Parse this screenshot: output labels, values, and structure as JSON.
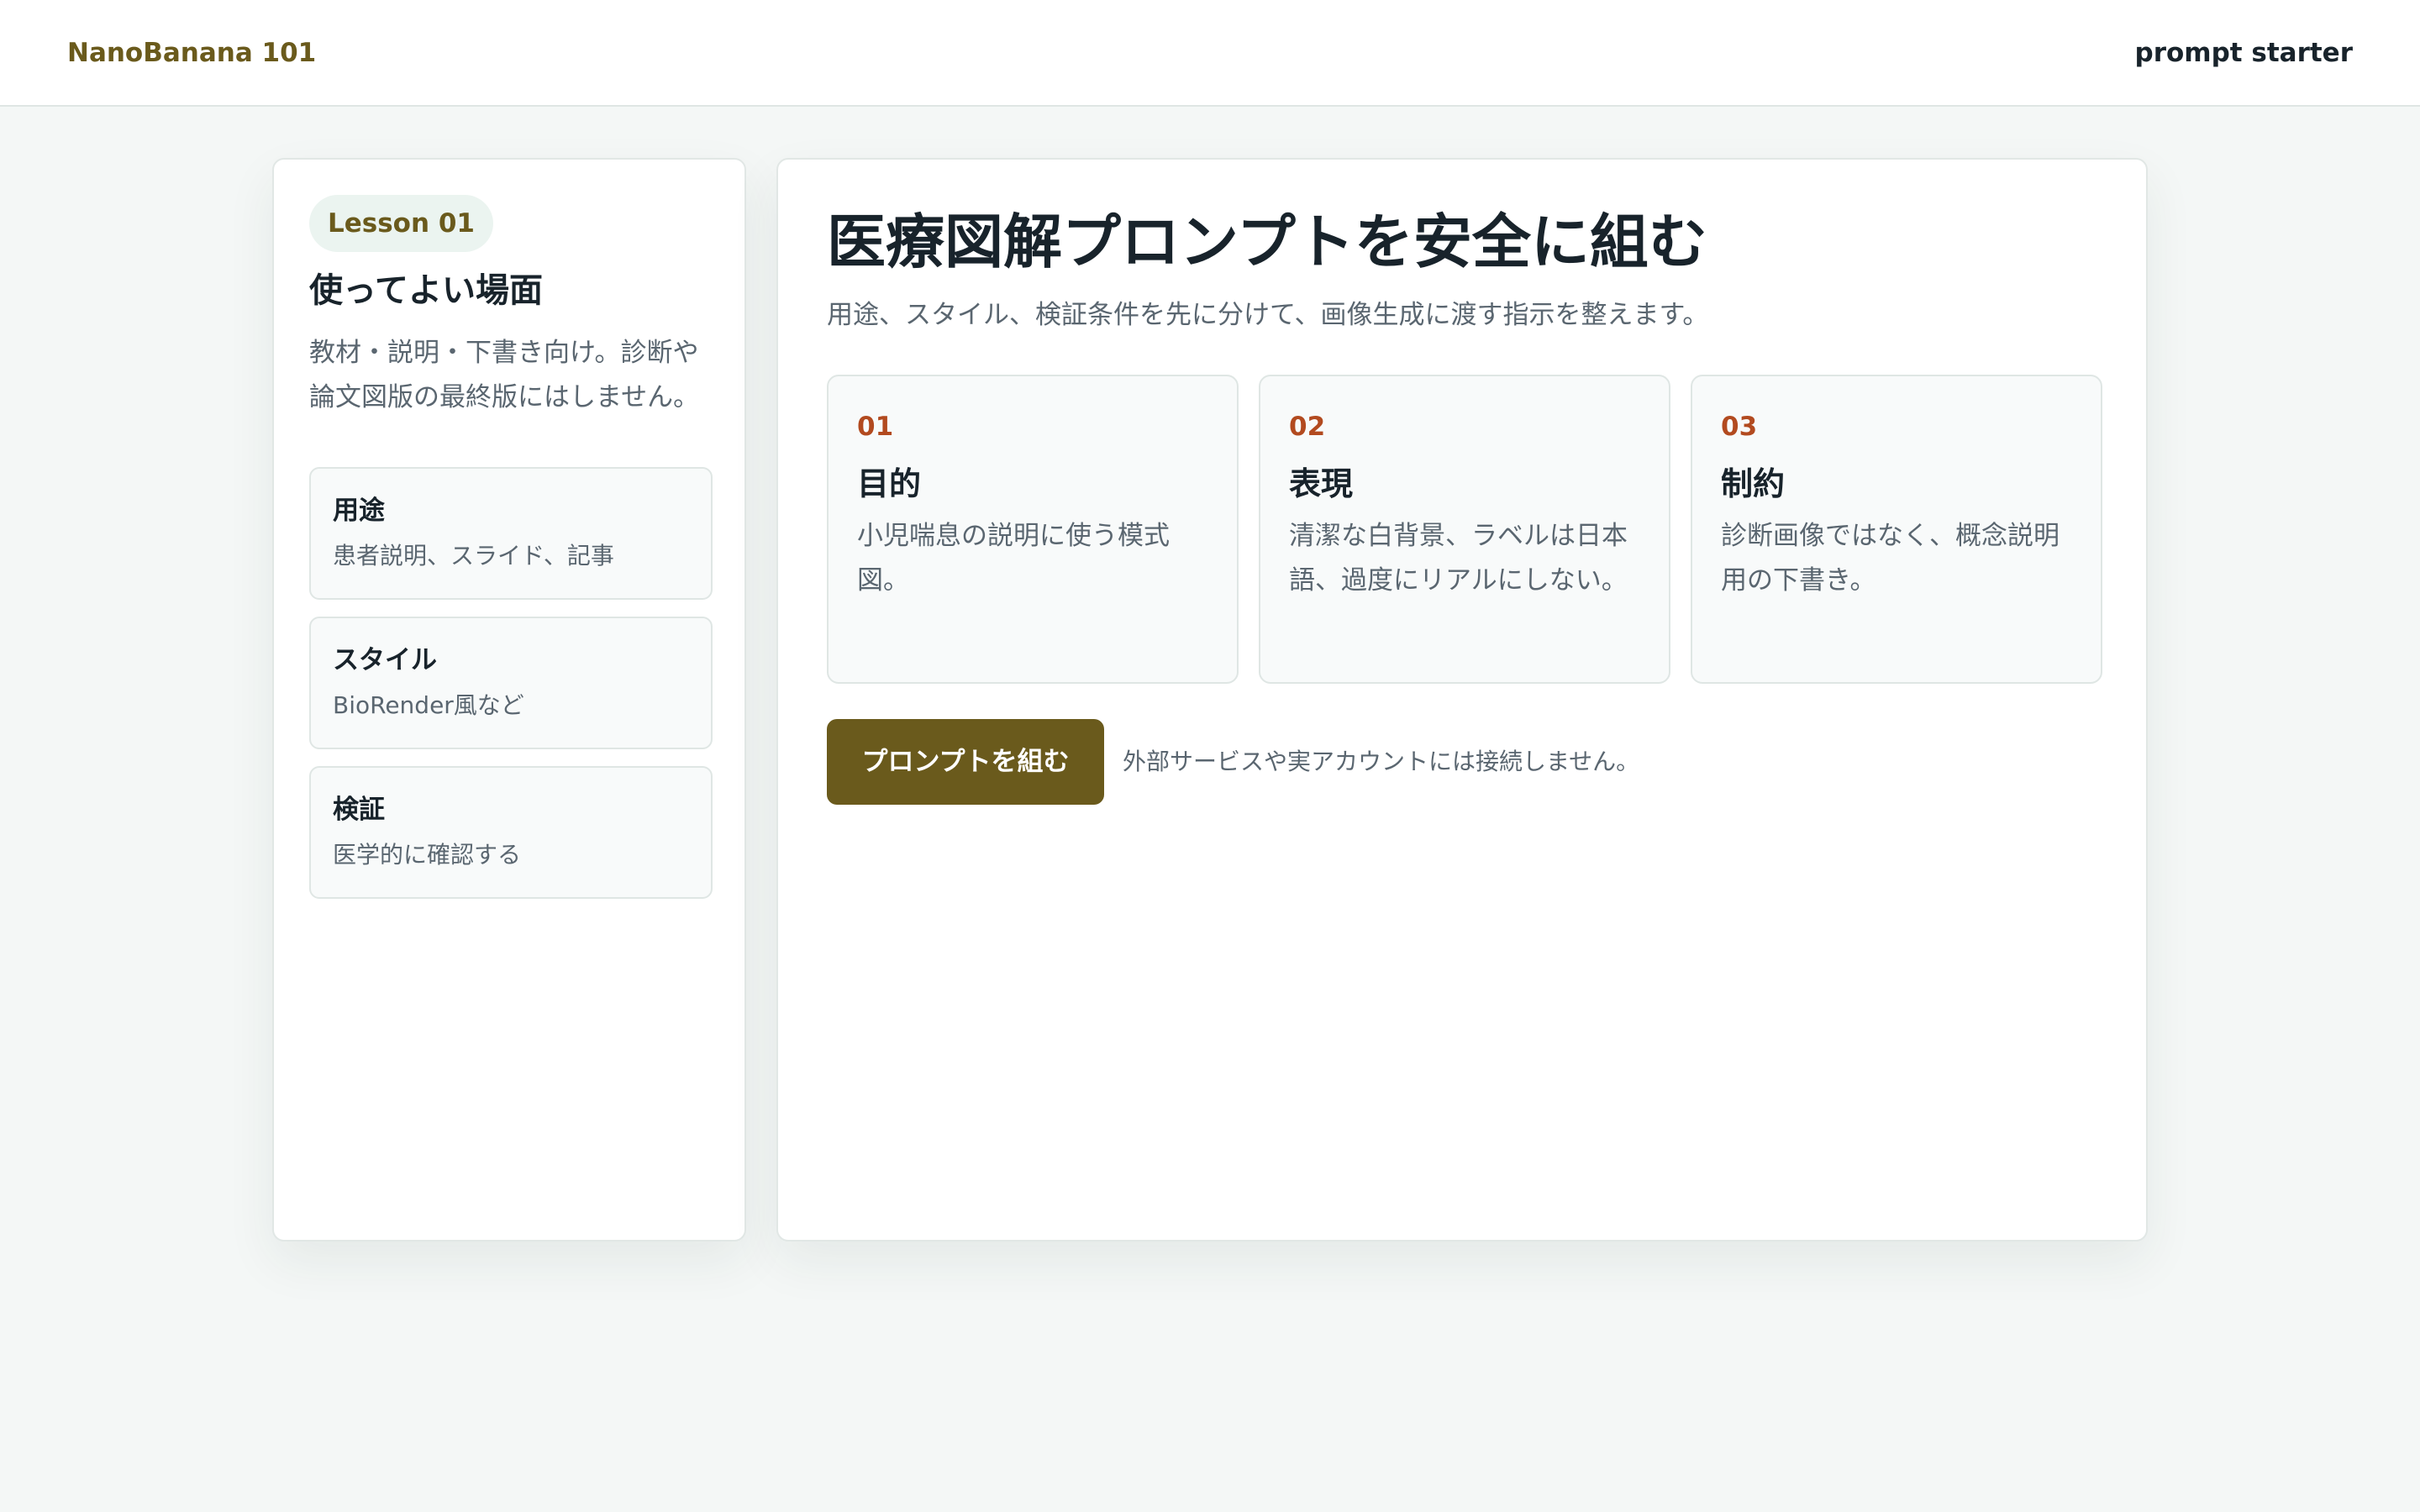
{
  "header": {
    "brand": "NanoBanana 101",
    "right_label": "prompt starter"
  },
  "sidebar": {
    "lesson_badge": "Lesson 01",
    "title": "使ってよい場面",
    "description": "教材・説明・下書き向け。診断や論文図版の最終版にはしません。",
    "items": [
      {
        "title": "用途",
        "subtitle": "患者説明、スライド、記事"
      },
      {
        "title": "スタイル",
        "subtitle": "BioRender風など"
      },
      {
        "title": "検証",
        "subtitle": "医学的に確認する"
      }
    ]
  },
  "main": {
    "title": "医療図解プロンプトを安全に組む",
    "lead": "用途、スタイル、検証条件を先に分けて、画像生成に渡す指示を整えます。",
    "steps": [
      {
        "num": "01",
        "title": "目的",
        "desc": "小児喘息の説明に使う模式図。"
      },
      {
        "num": "02",
        "title": "表現",
        "desc": "清潔な白背景、ラベルは日本語、過度にリアルにしない。"
      },
      {
        "num": "03",
        "title": "制約",
        "desc": "診断画像ではなく、概念説明用の下書き。"
      }
    ],
    "cta_label": "プロンプトを組む",
    "cta_note": "外部サービスや実アカウントには接続しません。"
  },
  "colors": {
    "accent": "#6a5a1c",
    "step_number": "#b24a1f",
    "background": "#f4f7f6"
  }
}
